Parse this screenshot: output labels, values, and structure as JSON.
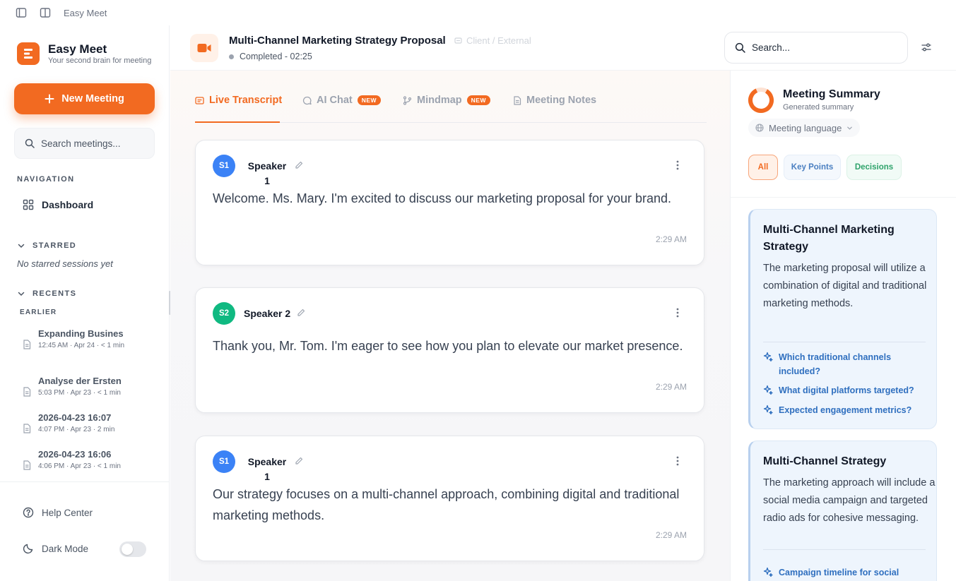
{
  "window": {
    "title": "Easy Meet"
  },
  "sidebar": {
    "brand_name": "Easy Meet",
    "brand_tagline": "Your second brain for meeting",
    "new_meeting_label": "New Meeting",
    "search_placeholder": "Search meetings...",
    "navigation_label": "NAVIGATION",
    "dashboard_label": "Dashboard",
    "starred_label": "STARRED",
    "starred_empty": "No starred sessions yet",
    "recents_label": "RECENTS",
    "earlier_label": "EARLIER",
    "recents": [
      {
        "title": "Expanding Busines",
        "meta": "12:45 AM · Apr 24 · < 1 min"
      },
      {
        "title": "Analyse der Ersten",
        "meta": "5:03 PM · Apr 23 · < 1 min"
      },
      {
        "title": "2026-04-23 16:07",
        "meta": "4:07 PM · Apr 23 · 2 min"
      },
      {
        "title": "2026-04-23 16:06",
        "meta": "4:06 PM · Apr 23 · < 1 min"
      }
    ],
    "help_label": "Help Center",
    "dark_mode_label": "Dark Mode",
    "dark_mode_on": false
  },
  "header": {
    "title": "Multi-Channel Marketing Strategy Proposal",
    "tag": "Client / External",
    "status": "Completed - 02:25",
    "search_placeholder": "Search..."
  },
  "tabs": [
    {
      "label": "Live Transcript",
      "active": true
    },
    {
      "label": "AI Chat",
      "badge": "NEW"
    },
    {
      "label": "Mindmap",
      "badge": "NEW"
    },
    {
      "label": "Meeting Notes"
    }
  ],
  "transcript": [
    {
      "initials": "S1",
      "speaker": "Speaker 1",
      "color": "#3b82f6",
      "text": "Welcome. Ms. Mary. I'm excited to discuss our marketing proposal for your brand.",
      "time": "2:29 AM"
    },
    {
      "initials": "S2",
      "speaker": "Speaker 2",
      "color": "#10b981",
      "text": "Thank you, Mr. Tom. I'm eager to see how you plan to elevate our market presence.",
      "time": "2:29 AM"
    },
    {
      "initials": "S1",
      "speaker": "Speaker 1",
      "color": "#3b82f6",
      "text": "Our strategy focuses on a multi-channel approach, combining digital and traditional marketing methods.",
      "time": "2:29 AM"
    }
  ],
  "summary": {
    "title": "Meeting Summary",
    "subtitle": "Generated summary",
    "language_label": "Meeting language",
    "filters": [
      "All",
      "Key Points",
      "Decisions"
    ],
    "cards": [
      {
        "title": "Multi-Channel Marketing Strategy",
        "body": "The marketing proposal will utilize a combination of digital and traditional marketing methods.",
        "questions": [
          "Which traditional channels included?",
          "What digital platforms targeted?",
          "Expected engagement metrics?"
        ]
      },
      {
        "title": "Multi-Channel Strategy",
        "body": "The marketing approach will include a social media campaign and targeted radio ads for cohesive messaging.",
        "questions": [
          "Campaign timeline for social"
        ]
      }
    ]
  },
  "colors": {
    "accent": "#f26a21",
    "blue_speaker": "#3b82f6",
    "green_speaker": "#10b981",
    "link": "#2f6fbf"
  }
}
